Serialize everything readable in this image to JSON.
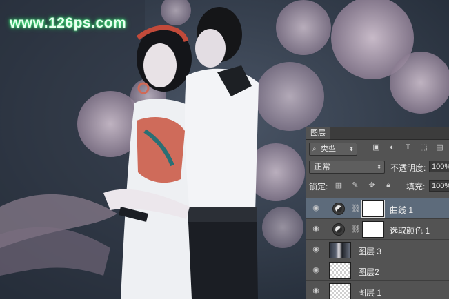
{
  "watermark": "www.126ps.com",
  "panel": {
    "tab_label": "图层",
    "filter_kind": "类型",
    "blend_mode": "正常",
    "opacity_label": "不透明度:",
    "opacity_value": "100%",
    "lock_label": "锁定:",
    "fill_label": "填充:",
    "fill_value": "100%"
  },
  "layers": [
    {
      "name": "曲线 1",
      "type": "adjustment",
      "selected": true
    },
    {
      "name": "选取颜色 1",
      "type": "adjustment",
      "selected": false
    },
    {
      "name": "图层 3",
      "type": "pixel-photo",
      "selected": false
    },
    {
      "name": "图层2",
      "type": "pixel-empty",
      "selected": false
    },
    {
      "name": "图层 1",
      "type": "pixel-empty",
      "selected": false
    }
  ],
  "icons": {
    "filter": [
      "image-filter-icon",
      "adjustment-filter-icon",
      "type-filter-icon",
      "shape-filter-icon",
      "smart-object-filter-icon"
    ],
    "lock": [
      "lock-transparent-icon",
      "lock-paint-icon",
      "lock-move-icon",
      "lock-all-icon"
    ]
  },
  "colors": {
    "panel_bg": "#535353",
    "selected_row": "#5d6b7b",
    "watermark_glow": "#3fe07a"
  }
}
